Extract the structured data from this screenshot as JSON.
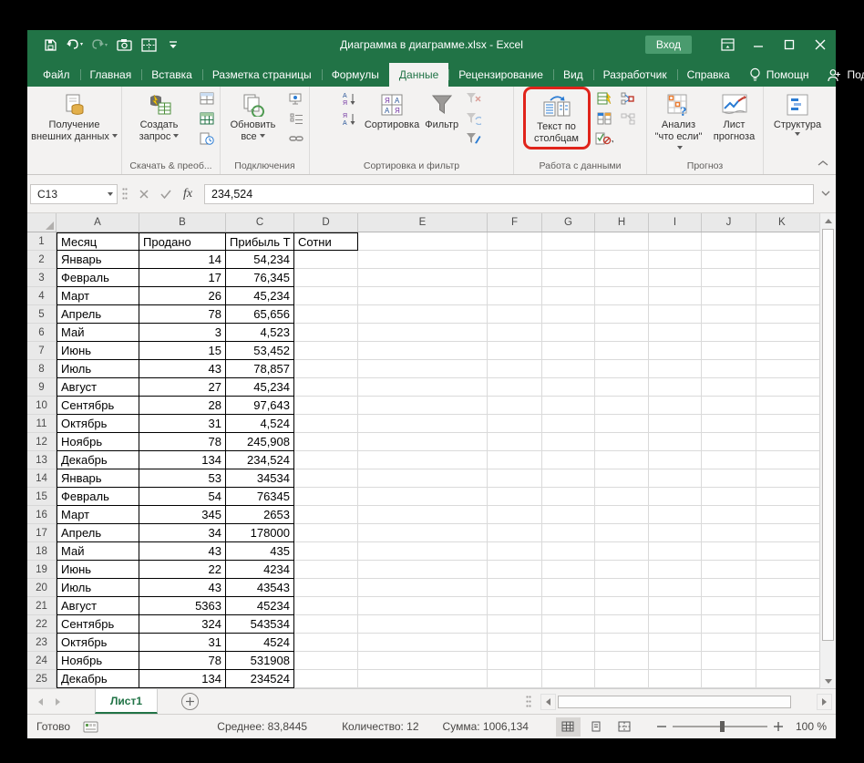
{
  "colors": {
    "accent_green": "#217346",
    "highlight_red": "#e0241b",
    "signin_bg": "#4a9b6e"
  },
  "titlebar": {
    "title": "Диаграмма в диаграмме.xlsx  -  Excel",
    "signin_label": "Вход"
  },
  "ribbon_tabs": [
    {
      "label": "Файл"
    },
    {
      "label": "Главная"
    },
    {
      "label": "Вставка"
    },
    {
      "label": "Разметка страницы"
    },
    {
      "label": "Формулы"
    },
    {
      "label": "Данные"
    },
    {
      "label": "Рецензирование"
    },
    {
      "label": "Вид"
    },
    {
      "label": "Разработчик"
    },
    {
      "label": "Справка"
    }
  ],
  "tabrow_right": {
    "assistant": "Помощн",
    "share": "Поделиться"
  },
  "ribbon": {
    "get_external": "Получение внешних данных",
    "new_query": "Создать запрос",
    "refresh_all": "Обновить все",
    "sort": "Сортировка",
    "filter": "Фильтр",
    "text_to_columns": "Текст по столбцам",
    "what_if": "Анализ \"что если\"",
    "forecast_sheet": "Лист прогноза",
    "structure": "Структура",
    "groups": {
      "get_transform": "Скачать & преоб...",
      "connections": "Подключения",
      "sort_filter": "Сортировка и фильтр",
      "data_tools": "Работа с данными",
      "forecast": "Прогноз"
    }
  },
  "formula_bar": {
    "name_box": "C13",
    "value": "234,524",
    "fx": "fx"
  },
  "sheet": {
    "col_headers": [
      "A",
      "B",
      "C",
      "D",
      "E",
      "F",
      "G",
      "H",
      "I",
      "J",
      "K"
    ],
    "rows": [
      {
        "n": "1",
        "a": "Месяц",
        "b": "Продано",
        "c": "Прибыль Т",
        "d": "Сотни"
      },
      {
        "n": "2",
        "a": "Январь",
        "b": "14",
        "c": "54,234",
        "d": ""
      },
      {
        "n": "3",
        "a": "Февраль",
        "b": "17",
        "c": "76,345",
        "d": ""
      },
      {
        "n": "4",
        "a": "Март",
        "b": "26",
        "c": "45,234",
        "d": ""
      },
      {
        "n": "5",
        "a": "Апрель",
        "b": "78",
        "c": "65,656",
        "d": ""
      },
      {
        "n": "6",
        "a": "Май",
        "b": "3",
        "c": "4,523",
        "d": ""
      },
      {
        "n": "7",
        "a": "Июнь",
        "b": "15",
        "c": "53,452",
        "d": ""
      },
      {
        "n": "8",
        "a": "Июль",
        "b": "43",
        "c": "78,857",
        "d": ""
      },
      {
        "n": "9",
        "a": "Август",
        "b": "27",
        "c": "45,234",
        "d": ""
      },
      {
        "n": "10",
        "a": "Сентябрь",
        "b": "28",
        "c": "97,643",
        "d": ""
      },
      {
        "n": "11",
        "a": "Октябрь",
        "b": "31",
        "c": "4,524",
        "d": ""
      },
      {
        "n": "12",
        "a": "Ноябрь",
        "b": "78",
        "c": "245,908",
        "d": ""
      },
      {
        "n": "13",
        "a": "Декабрь",
        "b": "134",
        "c": "234,524",
        "d": ""
      },
      {
        "n": "14",
        "a": "Январь",
        "b": "53",
        "c": "34534",
        "d": ""
      },
      {
        "n": "15",
        "a": "Февраль",
        "b": "54",
        "c": "76345",
        "d": ""
      },
      {
        "n": "16",
        "a": "Март",
        "b": "345",
        "c": "2653",
        "d": ""
      },
      {
        "n": "17",
        "a": "Апрель",
        "b": "34",
        "c": "178000",
        "d": ""
      },
      {
        "n": "18",
        "a": "Май",
        "b": "43",
        "c": "435",
        "d": ""
      },
      {
        "n": "19",
        "a": "Июнь",
        "b": "22",
        "c": "4234",
        "d": ""
      },
      {
        "n": "20",
        "a": "Июль",
        "b": "43",
        "c": "43543",
        "d": ""
      },
      {
        "n": "21",
        "a": "Август",
        "b": "5363",
        "c": "45234",
        "d": ""
      },
      {
        "n": "22",
        "a": "Сентябрь",
        "b": "324",
        "c": "543534",
        "d": ""
      },
      {
        "n": "23",
        "a": "Октябрь",
        "b": "31",
        "c": "4524",
        "d": ""
      },
      {
        "n": "24",
        "a": "Ноябрь",
        "b": "78",
        "c": "531908",
        "d": ""
      },
      {
        "n": "25",
        "a": "Декабрь",
        "b": "134",
        "c": "234524",
        "d": ""
      }
    ]
  },
  "sheet_tabs": {
    "sheet1": "Лист1"
  },
  "status_bar": {
    "ready": "Готово",
    "average": "Среднее: 83,8445",
    "count": "Количество: 12",
    "sum": "Сумма: 1006,134",
    "zoom": "100 %"
  }
}
